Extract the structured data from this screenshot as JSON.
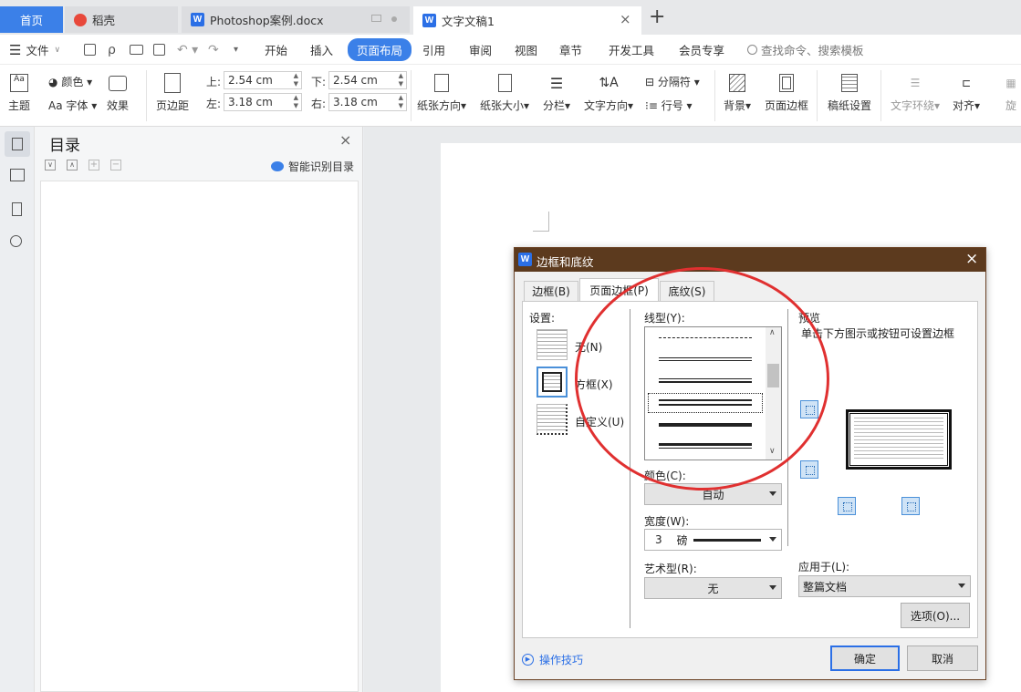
{
  "tabs": {
    "home": "首页",
    "daoke": "稻壳",
    "doc1": "Photoshop案例.docx",
    "doc2": "文字文稿1",
    "add": "+"
  },
  "menubar": {
    "file": "文件",
    "items": [
      "开始",
      "插入",
      "页面布局",
      "引用",
      "审阅",
      "视图",
      "章节",
      "开发工具",
      "会员专享"
    ],
    "active": "页面布局",
    "search": "查找命令、搜索模板"
  },
  "ribbon": {
    "theme": "主题",
    "color": "颜色",
    "font": "字体",
    "effect": "效果",
    "margin": "页边距",
    "top_label": "上:",
    "top_value": "2.54 cm",
    "bottom_label": "下:",
    "bottom_value": "2.54 cm",
    "left_label": "左:",
    "left_value": "3.18 cm",
    "right_label": "右:",
    "right_value": "3.18 cm",
    "orientation": "纸张方向",
    "size": "纸张大小",
    "columns": "分栏",
    "text_direction": "文字方向",
    "separator": "分隔符",
    "line_number": "行号",
    "background": "背景",
    "page_border": "页面边框",
    "grid_paper": "稿纸设置",
    "text_wrap": "文字环绕",
    "align": "对齐",
    "rotate": "旋"
  },
  "navpanel": {
    "title": "目录",
    "smart": "智能识别目录"
  },
  "dialog": {
    "title": "边框和底纹",
    "tabs": [
      "边框(B)",
      "页面边框(P)",
      "底纹(S)"
    ],
    "setting_label": "设置:",
    "settings": [
      "无(N)",
      "方框(X)",
      "自定义(U)"
    ],
    "line_style_label": "线型(Y):",
    "color_label": "颜色(C):",
    "color_value": "自动",
    "width_label": "宽度(W):",
    "width_value": "3",
    "width_unit": "磅",
    "art_label": "艺术型(R):",
    "art_value": "无",
    "preview_label": "预览",
    "preview_hint": "单击下方图示或按钮可设置边框",
    "apply_label": "应用于(L):",
    "apply_value": "整篇文档",
    "options": "选项(O)...",
    "tips": "操作技巧",
    "ok": "确定",
    "cancel": "取消"
  },
  "colors": {
    "accent": "#2b6fe6",
    "dialog_title": "#5c3a1e",
    "annotation": "#e03030"
  }
}
